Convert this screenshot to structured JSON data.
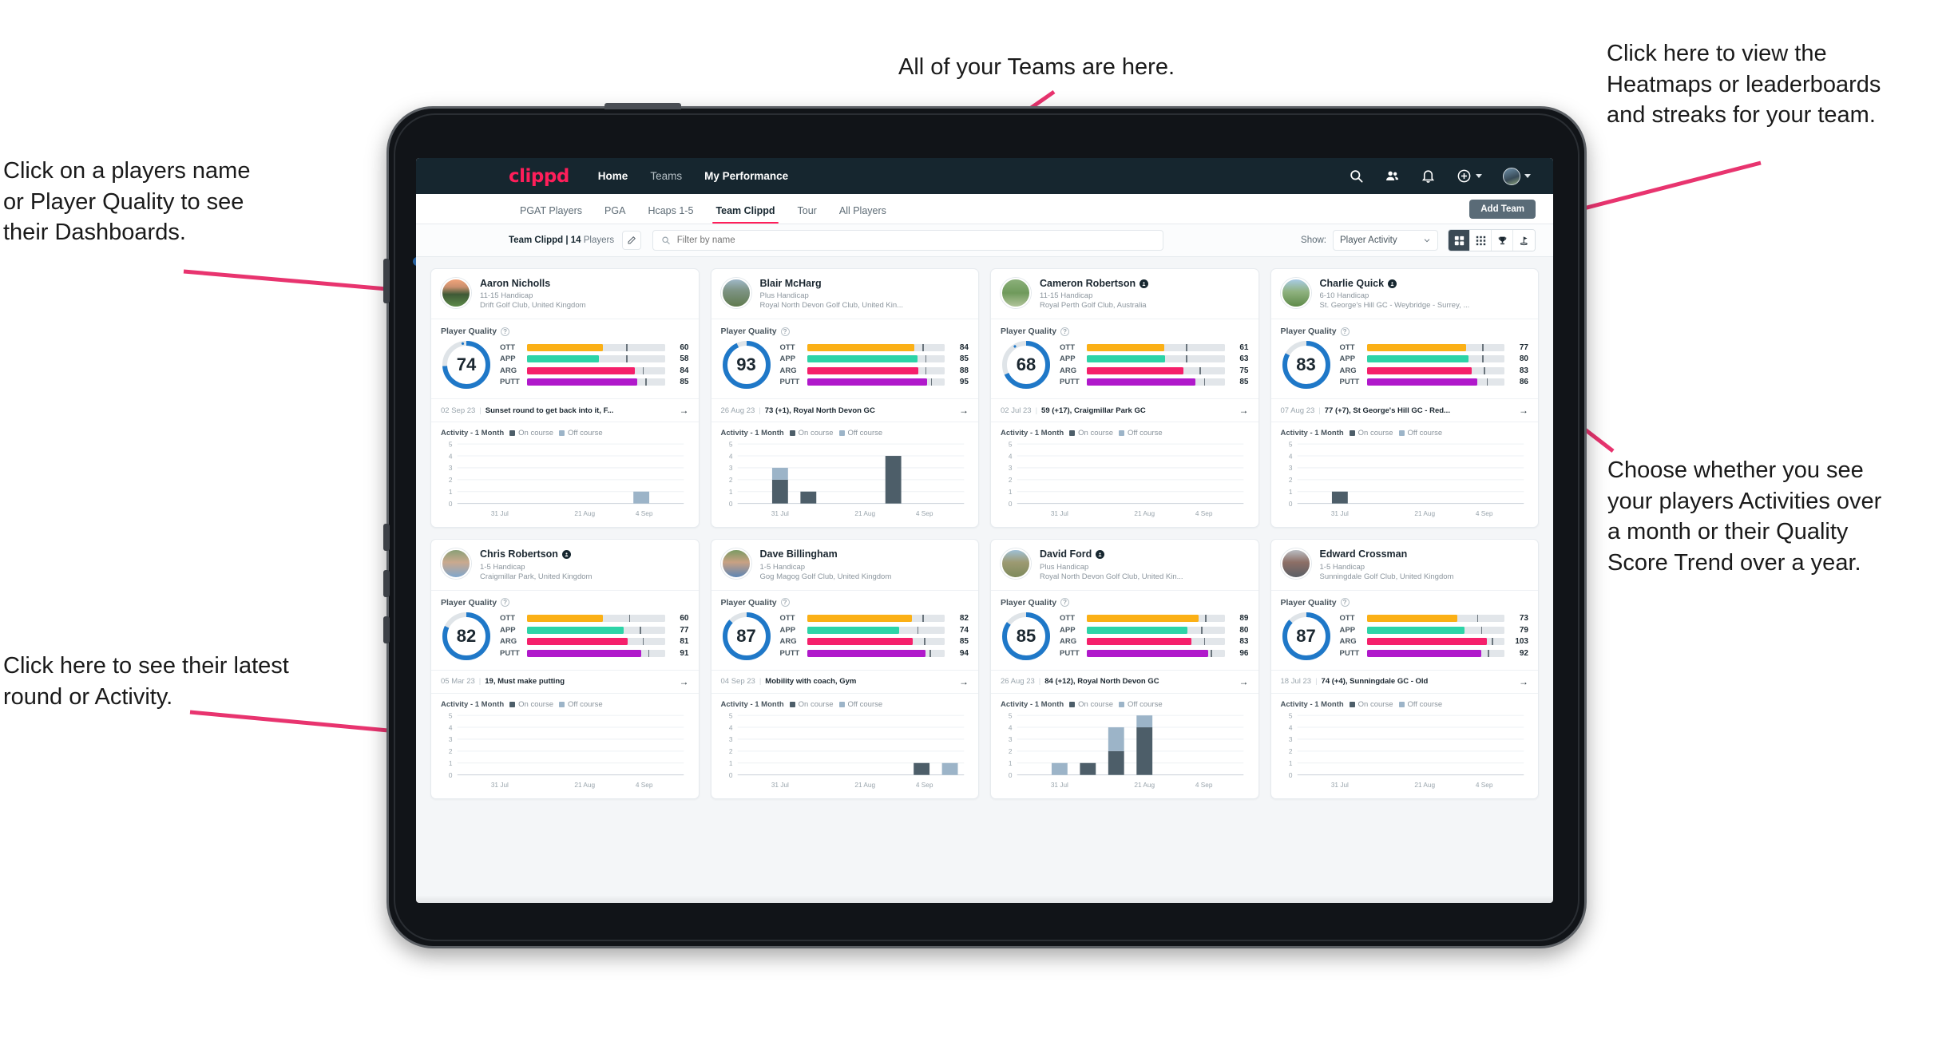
{
  "annotations": [
    {
      "id": "players-name",
      "text": "Click on a players name\nor Player Quality to see\ntheir Dashboards."
    },
    {
      "id": "teams",
      "text": "All of your Teams are here."
    },
    {
      "id": "heatmaps",
      "text": "Click here to view the\nHeatmaps or leaderboards\nand streaks for your team."
    },
    {
      "id": "activity-toggle",
      "text": "Choose whether you see\nyour players Activities over\na month or their Quality\nScore Trend over a year."
    },
    {
      "id": "latest-round",
      "text": "Click here to see their latest\nround or Activity."
    }
  ],
  "topnav": {
    "brand": "clippd",
    "links": [
      {
        "label": "Home",
        "active": true
      },
      {
        "label": "Teams",
        "active": false
      },
      {
        "label": "My Performance",
        "active": true
      }
    ],
    "icons": [
      "search-icon",
      "people-icon",
      "bell-icon",
      "plus-circle-icon",
      "avatar"
    ]
  },
  "tabs": [
    {
      "label": "PGAT Players",
      "active": false
    },
    {
      "label": "PGA",
      "active": false
    },
    {
      "label": "Hcaps 1-5",
      "active": false
    },
    {
      "label": "Team Clippd",
      "active": true
    },
    {
      "label": "Tour",
      "active": false
    },
    {
      "label": "All Players",
      "active": false
    }
  ],
  "add_team_label": "Add Team",
  "filterbar": {
    "team_name": "Team Clippd | 14",
    "team_suffix": "Players",
    "edit_icon": "pencil-icon",
    "search_placeholder": "Filter by name",
    "search_value": "",
    "show_label": "Show:",
    "select_value": "Player Activity",
    "view_buttons": [
      {
        "icon": "grid-large-icon",
        "active": true
      },
      {
        "icon": "grid-small-icon",
        "active": false
      },
      {
        "icon": "trophy-icon",
        "active": false
      },
      {
        "icon": "flag-icon",
        "active": false
      }
    ]
  },
  "colors": {
    "accent": "#ff1e5a",
    "navbar": "#16262f",
    "ring": "#1f78c8",
    "ott": "#fbb016",
    "app": "#2dd4a7",
    "arg": "#f5206b",
    "putt": "#b019cb",
    "on_course": "#4d5e69",
    "off_course": "#9cb4c8"
  },
  "quality_title": "Player Quality",
  "activity_title": "Activity - 1 Month",
  "legend": {
    "on": "On course",
    "off": "Off course"
  },
  "chart_data": {
    "type": "bar",
    "ylim": [
      0,
      5
    ],
    "yticks": [
      0,
      1,
      2,
      3,
      4,
      5
    ],
    "xticks": [
      "31 Jul",
      "21 Aug",
      "4 Sep"
    ],
    "series_names": [
      "On course",
      "Off course"
    ],
    "stacked": true,
    "charts": [
      {
        "player": "Aaron Nicholls",
        "bars": [
          {
            "slot": 6,
            "on": 0,
            "off": 1
          }
        ]
      },
      {
        "player": "Blair McHarg",
        "bars": [
          {
            "slot": 1,
            "on": 2,
            "off": 1
          },
          {
            "slot": 2,
            "on": 1,
            "off": 0
          },
          {
            "slot": 5,
            "on": 4,
            "off": 0
          }
        ]
      },
      {
        "player": "Cameron Robertson",
        "bars": []
      },
      {
        "player": "Charlie Quick",
        "bars": [
          {
            "slot": 1,
            "on": 1,
            "off": 0
          }
        ]
      },
      {
        "player": "Chris Robertson",
        "bars": []
      },
      {
        "player": "Dave Billingham",
        "bars": [
          {
            "slot": 6,
            "on": 1,
            "off": 0
          },
          {
            "slot": 7,
            "on": 0,
            "off": 1
          }
        ]
      },
      {
        "player": "David Ford",
        "bars": [
          {
            "slot": 1,
            "on": 0,
            "off": 1
          },
          {
            "slot": 2,
            "on": 1,
            "off": 0
          },
          {
            "slot": 3,
            "on": 2,
            "off": 2
          },
          {
            "slot": 4,
            "on": 4,
            "off": 1
          }
        ]
      },
      {
        "player": "Edward Crossman",
        "bars": []
      }
    ]
  },
  "players": [
    {
      "name": "Aaron Nicholls",
      "verified": false,
      "handicap": "11-15 Handicap",
      "club": "Drift Golf Club, United Kingdom",
      "score": 74,
      "metrics": [
        {
          "label": "OTT",
          "value": 60,
          "fill": 55,
          "tick": 72
        },
        {
          "label": "APP",
          "value": 58,
          "fill": 52,
          "tick": 72
        },
        {
          "label": "ARG",
          "value": 84,
          "fill": 78,
          "tick": 84
        },
        {
          "label": "PUTT",
          "value": 85,
          "fill": 80,
          "tick": 86
        }
      ],
      "round": {
        "date": "02 Sep 23",
        "text": "Sunset round to get back into it, F..."
      },
      "avatar": "sunset-golf-course"
    },
    {
      "name": "Blair McHarg",
      "verified": false,
      "handicap": "Plus Handicap",
      "club": "Royal North Devon Golf Club, United Kin...",
      "score": 93,
      "metrics": [
        {
          "label": "OTT",
          "value": 84,
          "fill": 78,
          "tick": 84
        },
        {
          "label": "APP",
          "value": 85,
          "fill": 80,
          "tick": 86
        },
        {
          "label": "ARG",
          "value": 88,
          "fill": 81,
          "tick": 86
        },
        {
          "label": "PUTT",
          "value": 95,
          "fill": 87,
          "tick": 90
        }
      ],
      "round": {
        "date": "26 Aug 23",
        "text": "73 (+1), Royal North Devon GC"
      },
      "avatar": "links-course"
    },
    {
      "name": "Cameron Robertson",
      "verified": true,
      "handicap": "11-15 Handicap",
      "club": "Royal Perth Golf Club, Australia",
      "score": 68,
      "metrics": [
        {
          "label": "OTT",
          "value": 61,
          "fill": 56,
          "tick": 72
        },
        {
          "label": "APP",
          "value": 63,
          "fill": 57,
          "tick": 72
        },
        {
          "label": "ARG",
          "value": 75,
          "fill": 70,
          "tick": 82
        },
        {
          "label": "PUTT",
          "value": 85,
          "fill": 79,
          "tick": 85
        }
      ],
      "round": {
        "date": "02 Jul 23",
        "text": "59 (+17), Craigmillar Park GC"
      },
      "avatar": "fairway"
    },
    {
      "name": "Charlie Quick",
      "verified": true,
      "handicap": "6-10 Handicap",
      "club": "St. George's Hill GC - Weybridge - Surrey, ...",
      "score": 83,
      "metrics": [
        {
          "label": "OTT",
          "value": 77,
          "fill": 72,
          "tick": 84
        },
        {
          "label": "APP",
          "value": 80,
          "fill": 74,
          "tick": 84
        },
        {
          "label": "ARG",
          "value": 83,
          "fill": 76,
          "tick": 85
        },
        {
          "label": "PUTT",
          "value": 86,
          "fill": 80,
          "tick": 87
        }
      ],
      "round": {
        "date": "07 Aug 23",
        "text": "77 (+7), St George's Hill GC - Red..."
      },
      "avatar": "green-sky"
    },
    {
      "name": "Chris Robertson",
      "verified": true,
      "handicap": "1-5 Handicap",
      "club": "Craigmillar Park, United Kingdom",
      "score": 82,
      "metrics": [
        {
          "label": "OTT",
          "value": 60,
          "fill": 55,
          "tick": 74
        },
        {
          "label": "APP",
          "value": 77,
          "fill": 70,
          "tick": 82
        },
        {
          "label": "ARG",
          "value": 81,
          "fill": 73,
          "tick": 84
        },
        {
          "label": "PUTT",
          "value": 91,
          "fill": 83,
          "tick": 88
        }
      ],
      "round": {
        "date": "05 Mar 23",
        "text": "19, Must make putting"
      },
      "avatar": "man-blue-shirt"
    },
    {
      "name": "Dave Billingham",
      "verified": false,
      "handicap": "1-5 Handicap",
      "club": "Gog Magog Golf Club, United Kingdom",
      "score": 87,
      "metrics": [
        {
          "label": "OTT",
          "value": 82,
          "fill": 76,
          "tick": 84
        },
        {
          "label": "APP",
          "value": 74,
          "fill": 67,
          "tick": 80
        },
        {
          "label": "ARG",
          "value": 85,
          "fill": 77,
          "tick": 85
        },
        {
          "label": "PUTT",
          "value": 94,
          "fill": 86,
          "tick": 89
        }
      ],
      "round": {
        "date": "04 Sep 23",
        "text": "Mobility with coach, Gym"
      },
      "avatar": "man-beard"
    },
    {
      "name": "David Ford",
      "verified": true,
      "handicap": "Plus Handicap",
      "club": "Royal North Devon Golf Club, United Kin...",
      "score": 85,
      "metrics": [
        {
          "label": "OTT",
          "value": 89,
          "fill": 81,
          "tick": 86
        },
        {
          "label": "APP",
          "value": 80,
          "fill": 73,
          "tick": 83
        },
        {
          "label": "ARG",
          "value": 83,
          "fill": 76,
          "tick": 85
        },
        {
          "label": "PUTT",
          "value": 96,
          "fill": 88,
          "tick": 90
        }
      ],
      "round": {
        "date": "26 Aug 23",
        "text": "84 (+12), Royal North Devon GC"
      },
      "avatar": "golfer-hill"
    },
    {
      "name": "Edward Crossman",
      "verified": false,
      "handicap": "1-5 Handicap",
      "club": "Sunningdale Golf Club, United Kingdom",
      "score": 87,
      "metrics": [
        {
          "label": "OTT",
          "value": 73,
          "fill": 66,
          "tick": 80
        },
        {
          "label": "APP",
          "value": 79,
          "fill": 71,
          "tick": 83
        },
        {
          "label": "ARG",
          "value": 103,
          "fill": 87,
          "tick": 91
        },
        {
          "label": "PUTT",
          "value": 92,
          "fill": 83,
          "tick": 88
        }
      ],
      "round": {
        "date": "18 Jul 23",
        "text": "74 (+4), Sunningdale GC - Old"
      },
      "avatar": "indoor-photo"
    }
  ]
}
